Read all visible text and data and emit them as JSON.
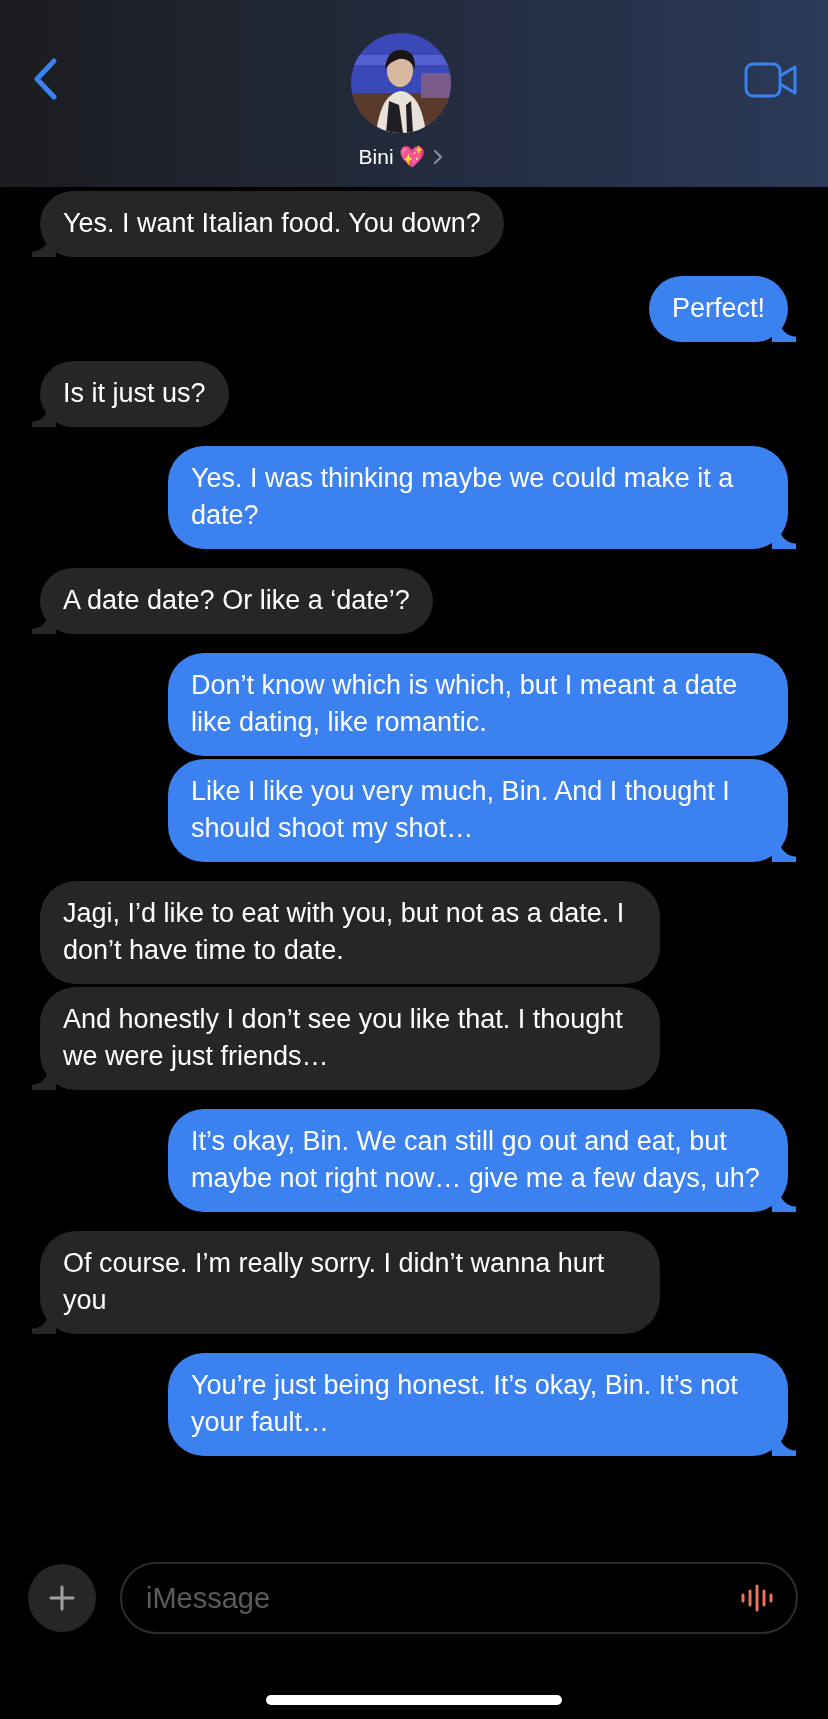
{
  "header": {
    "contact_name": "Bini 💖"
  },
  "messages": [
    {
      "kind": "incoming",
      "text": "Yes. I want Italian food. You down?",
      "tail": true
    },
    {
      "kind": "outgoing",
      "text": "Perfect!",
      "tail": true
    },
    {
      "kind": "incoming",
      "text": "Is it just us?",
      "tail": true
    },
    {
      "kind": "outgoing",
      "text": "Yes. I was thinking maybe we could make it a date?",
      "tail": true
    },
    {
      "kind": "incoming",
      "text": "A date date? Or like a ‘date’?",
      "tail": true
    },
    {
      "kind": "outgoing",
      "text": "Don’t know which is which, but I meant a date like dating, like romantic.",
      "tail": false
    },
    {
      "kind": "outgoing",
      "text": "Like I like you very much, Bin. And I thought I should shoot my shot…",
      "tail": true
    },
    {
      "kind": "incoming",
      "text": "Jagi, I’d like to eat with you, but not as a date. I don’t have time to date.",
      "tail": false
    },
    {
      "kind": "incoming",
      "text": "And honestly I don’t see you like that. I thought we were just friends…",
      "tail": true
    },
    {
      "kind": "outgoing",
      "text": "It’s okay, Bin. We can still go out and eat, but maybe not right now… give me a few days, uh?",
      "tail": true
    },
    {
      "kind": "incoming",
      "text": "Of course. I’m really sorry. I didn’t wanna hurt you",
      "tail": true
    },
    {
      "kind": "outgoing",
      "text": "You’re just being honest. It’s okay, Bin. It’s not your fault…",
      "tail": true
    }
  ],
  "composer": {
    "placeholder": "iMessage"
  }
}
